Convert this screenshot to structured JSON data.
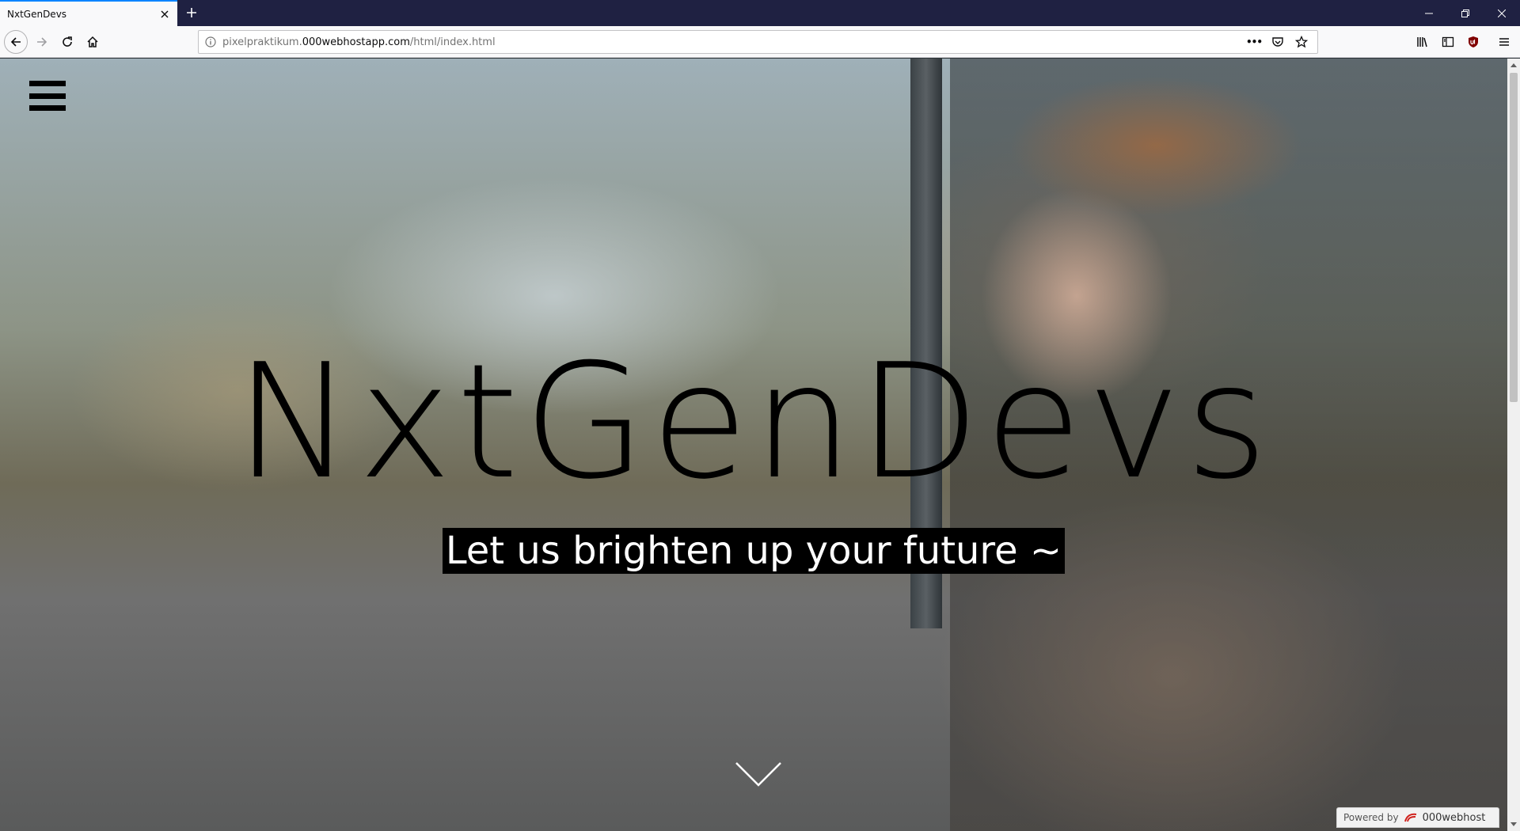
{
  "browser": {
    "tab_title": "NxtGenDevs",
    "url_prefix": "pixelpraktikum.",
    "url_host": "000webhostapp.com",
    "url_path": "/html/index.html",
    "page_actions_label": "•••"
  },
  "hero": {
    "title": "NxtGenDevs",
    "subtitle": "Let us brighten up your future ~"
  },
  "footer_badge": {
    "powered_label": "Powered by",
    "brand": "000webhost"
  },
  "colors": {
    "titlebar": "#1f2142",
    "tab_accent": "#0a84ff",
    "hero_text": "#000000",
    "subtitle_bg": "#000000",
    "subtitle_text": "#ffffff",
    "brand_red": "#d0211c"
  }
}
